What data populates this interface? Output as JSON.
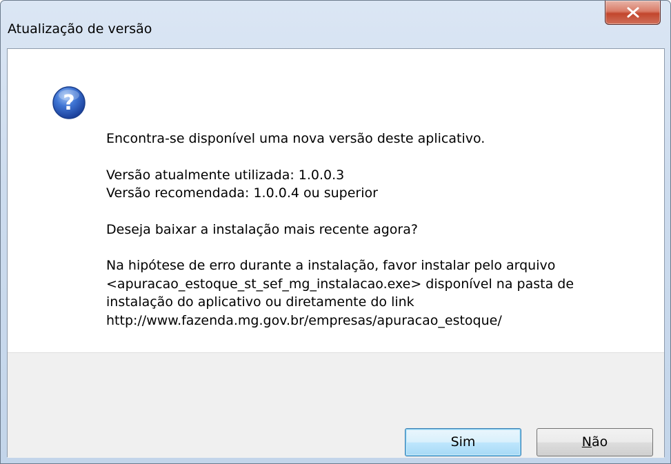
{
  "window": {
    "title": "Atualização de versão"
  },
  "icons": {
    "close": "close-x-icon",
    "dialog": "question-mark-icon"
  },
  "message": {
    "intro": "Encontra-se disponível uma nova versão deste aplicativo.",
    "current_version": "Versão atualmente utilizada: 1.0.0.3",
    "recommended_version": "Versão recomendada: 1.0.0.4 ou superior",
    "question": "Deseja baixar a instalação mais recente agora?",
    "note_line1": "Na hipótese de erro durante a instalação, favor instalar pelo arquivo",
    "note_line2": "<apuracao_estoque_st_sef_mg_instalacao.exe> disponível na pasta de",
    "note_line3": "instalação do aplicativo ou diretamente do link",
    "note_line4": "http://www.fazenda.mg.gov.br/empresas/apuracao_estoque/"
  },
  "buttons": {
    "yes_label": "Sim",
    "no_label_first": "N",
    "no_label_rest": "ão"
  },
  "colors": {
    "close_button": "#c2462d",
    "default_button_border": "#3c7fb1",
    "help_icon": "#2a5ab8"
  }
}
